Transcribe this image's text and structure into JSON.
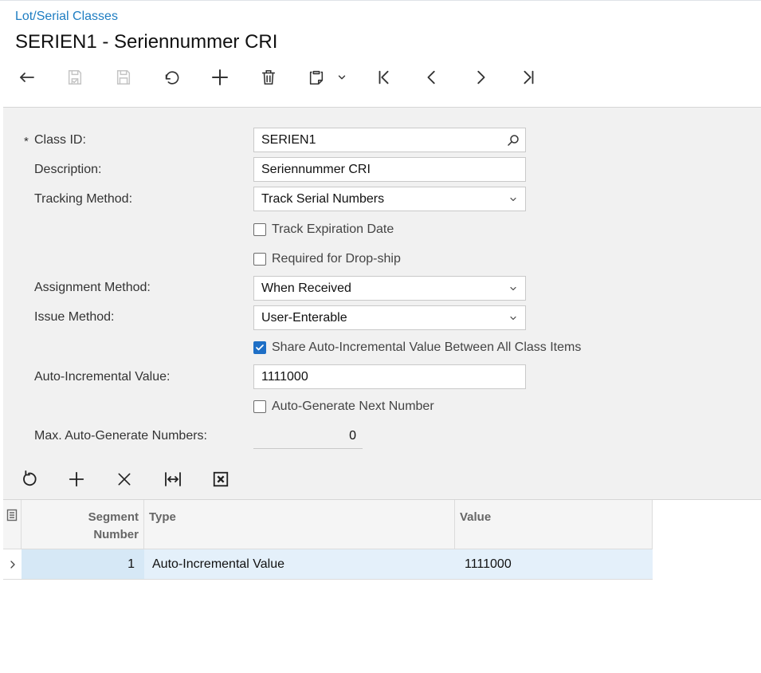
{
  "breadcrumb": "Lot/Serial Classes",
  "page_title": "SERIEN1 - Seriennummer CRI",
  "form": {
    "class_id": {
      "label": "Class ID:",
      "required_mark": "*",
      "value": "SERIEN1"
    },
    "description": {
      "label": "Description:",
      "value": "Seriennummer CRI"
    },
    "tracking_method": {
      "label": "Tracking Method:",
      "value": "Track Serial Numbers"
    },
    "track_expiration_date": {
      "label": "Track Expiration Date",
      "checked": false
    },
    "required_for_drop_ship": {
      "label": "Required for Drop-ship",
      "checked": false
    },
    "assignment_method": {
      "label": "Assignment Method:",
      "value": "When Received"
    },
    "issue_method": {
      "label": "Issue Method:",
      "value": "User-Enterable"
    },
    "share_auto_incremental": {
      "label": "Share Auto-Incremental Value Between All Class Items",
      "checked": true
    },
    "auto_incremental_value": {
      "label": "Auto-Incremental Value:",
      "value": "1111000"
    },
    "auto_generate_next_number": {
      "label": "Auto-Generate Next Number",
      "checked": false
    },
    "max_auto_generate_numbers": {
      "label": "Max. Auto-Generate Numbers:",
      "value": "0"
    }
  },
  "grid": {
    "columns": {
      "segment_number_line1": "Segment",
      "segment_number_line2": "Number",
      "type": "Type",
      "value": "Value"
    },
    "rows": [
      {
        "segment_number": "1",
        "type": "Auto-Incremental Value",
        "value": "1111000"
      }
    ]
  },
  "colors": {
    "link": "#1e7dc2",
    "accent": "#1e6fc6",
    "selected_row": "#e4f0fa",
    "form_background": "#f1f1f1"
  }
}
